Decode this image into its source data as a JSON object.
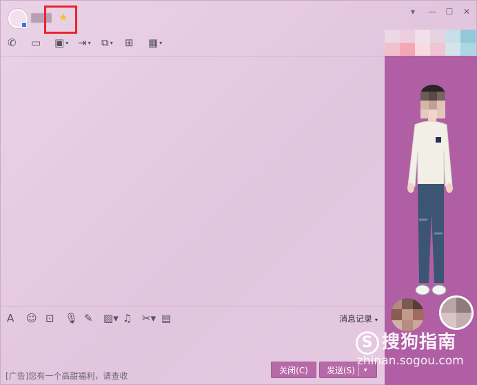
{
  "titlebar": {
    "level_icon": "star-badge-icon",
    "controls": [
      "chevron-down-icon",
      "minimize-icon",
      "maximize-icon",
      "close-icon"
    ],
    "control_glyphs": [
      "▾",
      "—",
      "☐",
      "✕"
    ]
  },
  "toolbar": {
    "icons": [
      {
        "name": "phone-icon",
        "glyph": "✆",
        "arrow": ""
      },
      {
        "name": "video-icon",
        "glyph": "▭",
        "arrow": ""
      },
      {
        "name": "screen-share-icon",
        "glyph": "▣",
        "arrow": "▾"
      },
      {
        "name": "file-transfer-icon",
        "glyph": "⇥",
        "arrow": "▾"
      },
      {
        "name": "remote-desktop-icon",
        "glyph": "⧉",
        "arrow": "▾"
      },
      {
        "name": "whiteboard-icon",
        "glyph": "⊞",
        "arrow": ""
      },
      {
        "name": "apps-icon",
        "glyph": "▦",
        "arrow": "▾"
      }
    ]
  },
  "input_toolbar": {
    "icons": [
      {
        "name": "font-icon",
        "glyph": "A",
        "arrow": ""
      },
      {
        "name": "emoji-icon",
        "glyph": "☺",
        "arrow": ""
      },
      {
        "name": "shake-icon",
        "glyph": "⊡",
        "arrow": ""
      },
      {
        "name": "voice-icon",
        "glyph": "🎙",
        "arrow": ""
      },
      {
        "name": "doodle-icon",
        "glyph": "✎",
        "arrow": ""
      },
      {
        "name": "image-icon",
        "glyph": "▨",
        "arrow": "▾"
      },
      {
        "name": "music-icon",
        "glyph": "♫",
        "arrow": ""
      },
      {
        "name": "screenshot-icon",
        "glyph": "✂",
        "arrow": "▾"
      },
      {
        "name": "red-packet-icon",
        "glyph": "▤",
        "arrow": ""
      }
    ],
    "history_label": "消息记录",
    "history_arrow": "▾"
  },
  "footer": {
    "ad_text": "[广告]您有一个高甜福利，请查收",
    "close_label": "关闭(C)",
    "send_label": "发送(S)",
    "send_arrow": "▾"
  },
  "watermark": {
    "logo_letter": "S",
    "brand": "搜狗指南",
    "url": "zhinan.sogou.com"
  },
  "colors": {
    "accent": "#b05fa4",
    "button": "#b76aa8",
    "highlight_box": "#e8242b",
    "background": "#e6cbe2"
  }
}
